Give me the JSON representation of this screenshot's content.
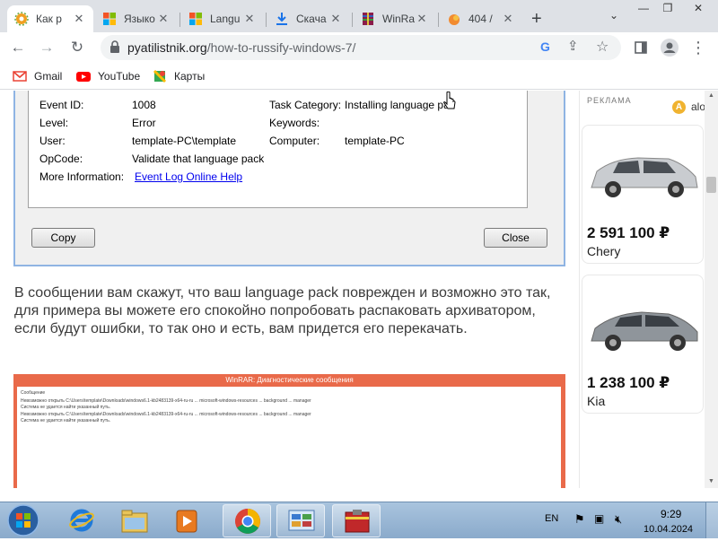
{
  "browser": {
    "tabs": [
      {
        "title": "Как р",
        "icon": "gear-icon",
        "active": true
      },
      {
        "title": "Языко",
        "icon": "windows-logo-icon",
        "active": false
      },
      {
        "title": "Langu",
        "icon": "windows-logo-icon",
        "active": false
      },
      {
        "title": "Скача",
        "icon": "download-icon",
        "active": false
      },
      {
        "title": "WinRa",
        "icon": "winrar-icon",
        "active": false
      },
      {
        "title": "404 /",
        "icon": "fire-icon",
        "active": false
      }
    ],
    "new_tab": "+",
    "url_domain": "pyatilistnik.org",
    "url_path": "/how-to-russify-windows-7/",
    "bookmarks": [
      {
        "label": "Gmail",
        "icon": "gmail-icon"
      },
      {
        "label": "YouTube",
        "icon": "youtube-icon"
      },
      {
        "label": "Карты",
        "icon": "maps-icon"
      }
    ]
  },
  "dialog": {
    "rows_left": [
      {
        "key": "Event ID:",
        "value": "1008"
      },
      {
        "key": "Level:",
        "value": "Error"
      },
      {
        "key": "User:",
        "value": "template-PC\\template"
      },
      {
        "key": "OpCode:",
        "value": "Validate that language pack"
      },
      {
        "key": "More Information:",
        "value": "Event Log Online Help"
      }
    ],
    "rows_right": [
      {
        "key": "Task Category:",
        "value": "Installing language pa"
      },
      {
        "key": "Keywords:",
        "value": ""
      },
      {
        "key": "Computer:",
        "value": "template-PC"
      }
    ],
    "copy_label": "Copy",
    "close_label": "Close"
  },
  "article": {
    "paragraph": "В сообщении вам скажут, что ваш language pack поврежден и возможно это так, для примера вы можете его спокойно попробовать распаковать архиватором, если будут ошибки, то так оно и есть, вам придется его перекачать."
  },
  "winrar_screenshot": {
    "title": "WinRAR: Диагностические сообщения",
    "lines": [
      "Сообщение",
      "Невозможно открыть C:\\Users\\template\\Downloads\\windows6.1-kb2483139-x64-ru-ru ... microsoft-windows-resources ... background ... manager",
      "Система не удается найти указанный путь.",
      "Невозможно открыть C:\\Users\\template\\Downloads\\windows6.1-kb2483139-x64-ru-ru ... microsoft-windows-resources ... background ... manager",
      "Система не удается найти указанный путь."
    ]
  },
  "ad": {
    "label": "РЕКЛАМА",
    "badge": "A",
    "badge_text": "alo",
    "cards": [
      {
        "price": "2 591 100 ₽",
        "brand": "Chery",
        "car_color": "#c9ccd0"
      },
      {
        "price": "1 238 100 ₽",
        "brand": "Kia",
        "car_color": "#8f959b"
      }
    ]
  },
  "taskbar": {
    "apps": [
      {
        "name": "internet-explorer-icon",
        "open": false
      },
      {
        "name": "file-explorer-icon",
        "open": false
      },
      {
        "name": "media-player-icon",
        "open": false
      },
      {
        "name": "chrome-icon",
        "open": true
      },
      {
        "name": "control-panel-icon",
        "open": true
      },
      {
        "name": "winrar-icon",
        "open": true
      }
    ],
    "language": "EN",
    "time": "9:29",
    "date": "10.04.2024"
  },
  "colors": {
    "tabstrip": "#dee1e6",
    "dialog_border": "#8fb4e3",
    "winrar_title": "#e96a4a",
    "taskbar": "#9bb7d4"
  }
}
